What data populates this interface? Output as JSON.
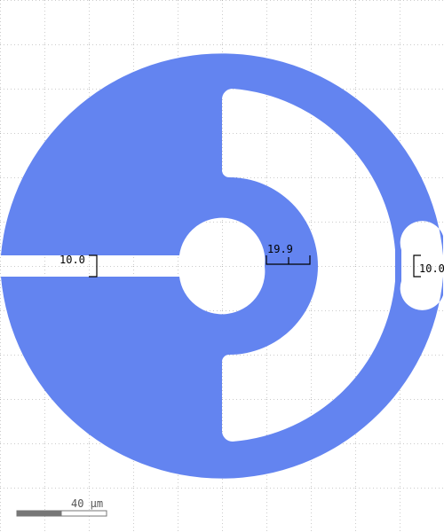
{
  "colors": {
    "shape": "#6384f0",
    "background": "#ffffff",
    "grid": "#9a9a9a",
    "dimension": "#000000",
    "scale_dark": "#777777",
    "scale_light": "#ffffff",
    "scale_text": "#555555"
  },
  "dimensions": {
    "left_gap": "10.0",
    "center_width": "19.9",
    "right_gap": "10.0"
  },
  "scale_bar": {
    "label": "40 µm"
  }
}
